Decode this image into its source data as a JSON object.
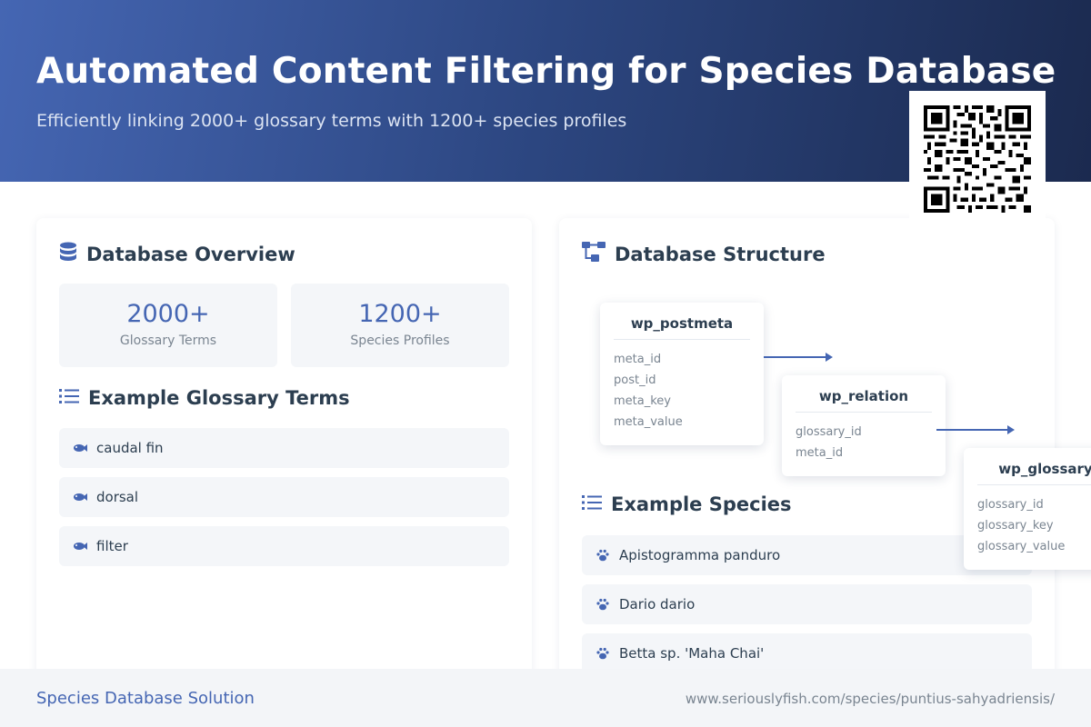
{
  "header": {
    "title": "Automated Content Filtering for Species Database",
    "subtitle": "Efficiently linking 2000+ glossary terms with 1200+ species profiles"
  },
  "overview": {
    "title": "Database Overview",
    "stats": [
      {
        "value": "2000+",
        "label": "Glossary Terms"
      },
      {
        "value": "1200+",
        "label": "Species Profiles"
      }
    ]
  },
  "glossary": {
    "title": "Example Glossary Terms",
    "items": [
      "caudal fin",
      "dorsal",
      "filter"
    ]
  },
  "structure": {
    "title": "Database Structure",
    "tables": [
      {
        "name": "wp_postmeta",
        "fields": [
          "meta_id",
          "post_id",
          "meta_key",
          "meta_value"
        ]
      },
      {
        "name": "wp_relation",
        "fields": [
          "glossary_id",
          "meta_id"
        ]
      },
      {
        "name": "wp_glossary",
        "fields": [
          "glossary_id",
          "glossary_key",
          "glossary_value"
        ]
      }
    ]
  },
  "species": {
    "title": "Example Species",
    "items": [
      "Apistogramma panduro",
      "Dario dario",
      "Betta sp. 'Maha Chai'"
    ]
  },
  "footer": {
    "left": "Species Database Solution",
    "right": "www.seriouslyfish.com/species/puntius-sahyadriensis/"
  },
  "icons": {
    "overview": "database-icon",
    "glossary": "list-icon",
    "glossary_item": "fish-icon",
    "structure": "diagram-icon",
    "species": "list-icon",
    "species_item": "paw-icon",
    "qr": "qr-code"
  },
  "colors": {
    "accent": "#4566b3",
    "header_start": "#4566b3",
    "header_end": "#1b2a4f",
    "text": "#2c3e50",
    "muted": "#7a8591"
  }
}
